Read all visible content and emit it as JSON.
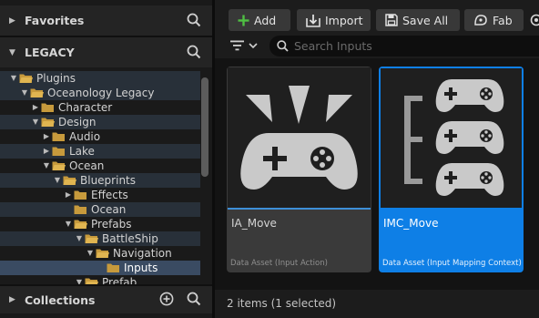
{
  "sidebar": {
    "favorites": {
      "label": "Favorites",
      "arrow": "▶"
    },
    "legacy": {
      "label": "LEGACY",
      "arrow": "▼"
    },
    "collections": {
      "label": "Collections",
      "arrow": "▶"
    },
    "tree": [
      {
        "label": "Plugins",
        "expanded": true
      },
      {
        "label": "Oceanology Legacy",
        "expanded": true
      },
      {
        "label": "Character",
        "expanded": false
      },
      {
        "label": "Design",
        "expanded": true
      },
      {
        "label": "Audio",
        "expanded": false
      },
      {
        "label": "Lake",
        "expanded": false
      },
      {
        "label": "Ocean",
        "expanded": true
      },
      {
        "label": "Blueprints",
        "expanded": true
      },
      {
        "label": "Effects",
        "expanded": false
      },
      {
        "label": "Ocean",
        "expanded": null
      },
      {
        "label": "Prefabs",
        "expanded": true
      },
      {
        "label": "BattleShip",
        "expanded": true
      },
      {
        "label": "Navigation",
        "expanded": true
      },
      {
        "label": "Inputs",
        "expanded": null,
        "selected": true
      },
      {
        "label": "Prefab",
        "expanded": true
      }
    ]
  },
  "toolbar": {
    "add_label": "Add",
    "import_label": "Import",
    "save_all_label": "Save All",
    "fab_label": "Fab"
  },
  "search": {
    "placeholder": "Search Inputs",
    "value": ""
  },
  "assets": [
    {
      "name": "IA_Move",
      "type": "Data Asset (Input Action)",
      "selected": false,
      "icon": "input-action-icon"
    },
    {
      "name": "IMC_Move",
      "type": "Data Asset (Input Mapping Context)",
      "selected": true,
      "icon": "input-mapping-context-icon"
    }
  ],
  "status": {
    "text": "2 items (1 selected)"
  },
  "colors": {
    "folder": "#c79a3c",
    "selection_blue": "#0e7fe6",
    "add_green": "#4fbf43",
    "tree_selected": "#3a4b62"
  }
}
